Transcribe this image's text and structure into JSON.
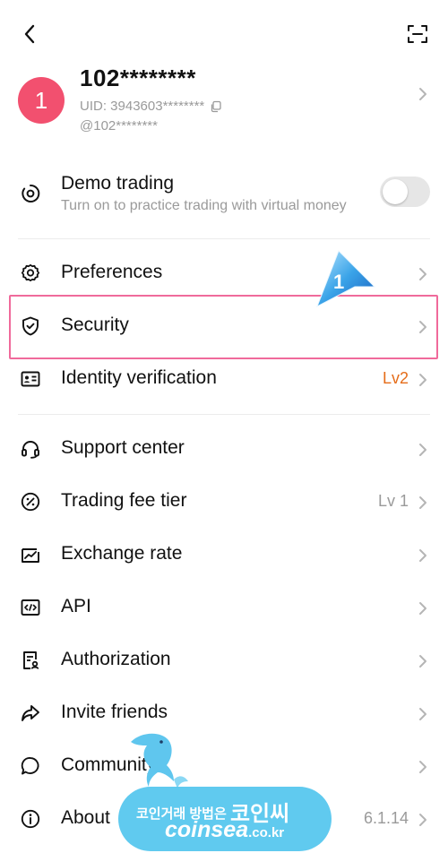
{
  "header": {
    "back_icon": "chevron-left-icon",
    "scan_icon": "scan-icon"
  },
  "profile": {
    "avatar_text": "1",
    "avatar_color": "#f2506f",
    "username": "102********",
    "uid": "UID: 3943603********",
    "copy_icon": "copy-icon",
    "handle": "@102********"
  },
  "demo_trading": {
    "label": "Demo trading",
    "subtitle": "Turn on to practice trading with virtual money",
    "toggle_on": false
  },
  "menu": {
    "preferences": {
      "label": "Preferences",
      "icon": "gear-icon"
    },
    "security": {
      "label": "Security",
      "icon": "shield-check-icon"
    },
    "identity": {
      "label": "Identity verification",
      "value": "Lv2",
      "icon": "id-card-icon"
    },
    "support": {
      "label": "Support center",
      "icon": "headset-icon"
    },
    "fee": {
      "label": "Trading fee tier",
      "value": "Lv 1",
      "icon": "percent-icon"
    },
    "exchange": {
      "label": "Exchange rate",
      "icon": "exchange-chart-icon"
    },
    "api": {
      "label": "API",
      "icon": "code-icon"
    },
    "authorization": {
      "label": "Authorization",
      "icon": "authorization-doc-icon"
    },
    "invite": {
      "label": "Invite friends",
      "icon": "share-arrow-icon"
    },
    "community": {
      "label": "Community",
      "icon": "chat-bubble-icon"
    },
    "about": {
      "label": "About",
      "value": "6.1.14",
      "icon": "info-icon"
    }
  },
  "annotation": {
    "step_number": "1",
    "highlight_color": "#f06a9b"
  },
  "watermark": {
    "line1_prefix": "코인거래 방법은",
    "line1_brand": "코인씨",
    "line2_brand": "coinsea",
    "line2_domain": ".co.kr"
  },
  "colors": {
    "accent_orange": "#e56d1a",
    "muted_text": "#9a9a9a",
    "toggle_off": "#e6e6e6"
  }
}
